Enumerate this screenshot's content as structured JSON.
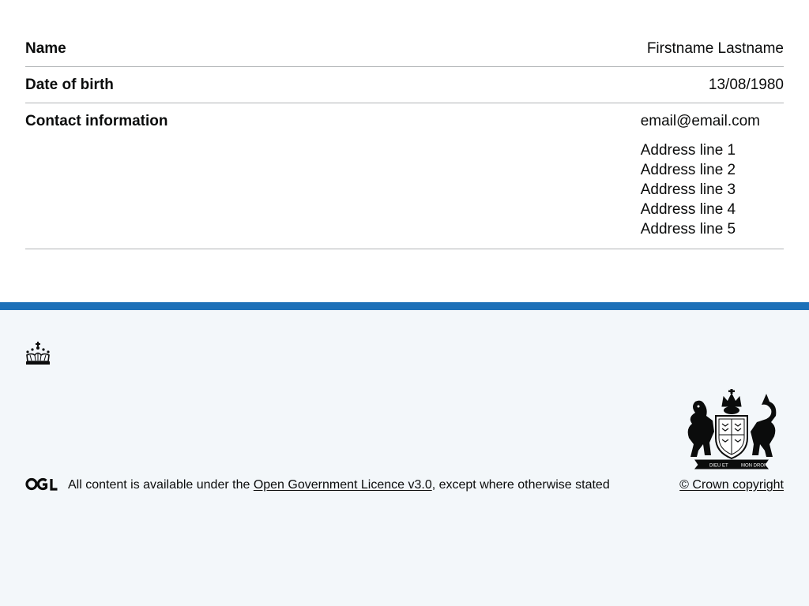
{
  "summary": {
    "rows": [
      {
        "key": "Name",
        "value": "Firstname Lastname"
      },
      {
        "key": "Date of birth",
        "value": "13/08/1980"
      },
      {
        "key": "Contact information",
        "email": "email@email.com",
        "address": [
          "Address line 1",
          "Address line 2",
          "Address line 3",
          "Address line 4",
          "Address line 5"
        ]
      }
    ]
  },
  "footer": {
    "licence_prefix": "All content is available under the ",
    "licence_link": "Open Government Licence v3.0",
    "licence_suffix": ", except where otherwise stated",
    "copyright": "© Crown copyright",
    "crown_logo_icon": "crown-icon",
    "ogl_logo_icon": "ogl-logo-icon",
    "coat_of_arms_icon": "royal-coat-of-arms-icon",
    "coat_of_arms_motto_left": "DIEU ET",
    "coat_of_arms_motto_right": "MON DROIT",
    "accent_color": "#1d70b8",
    "background_color": "#f3f7fa"
  }
}
